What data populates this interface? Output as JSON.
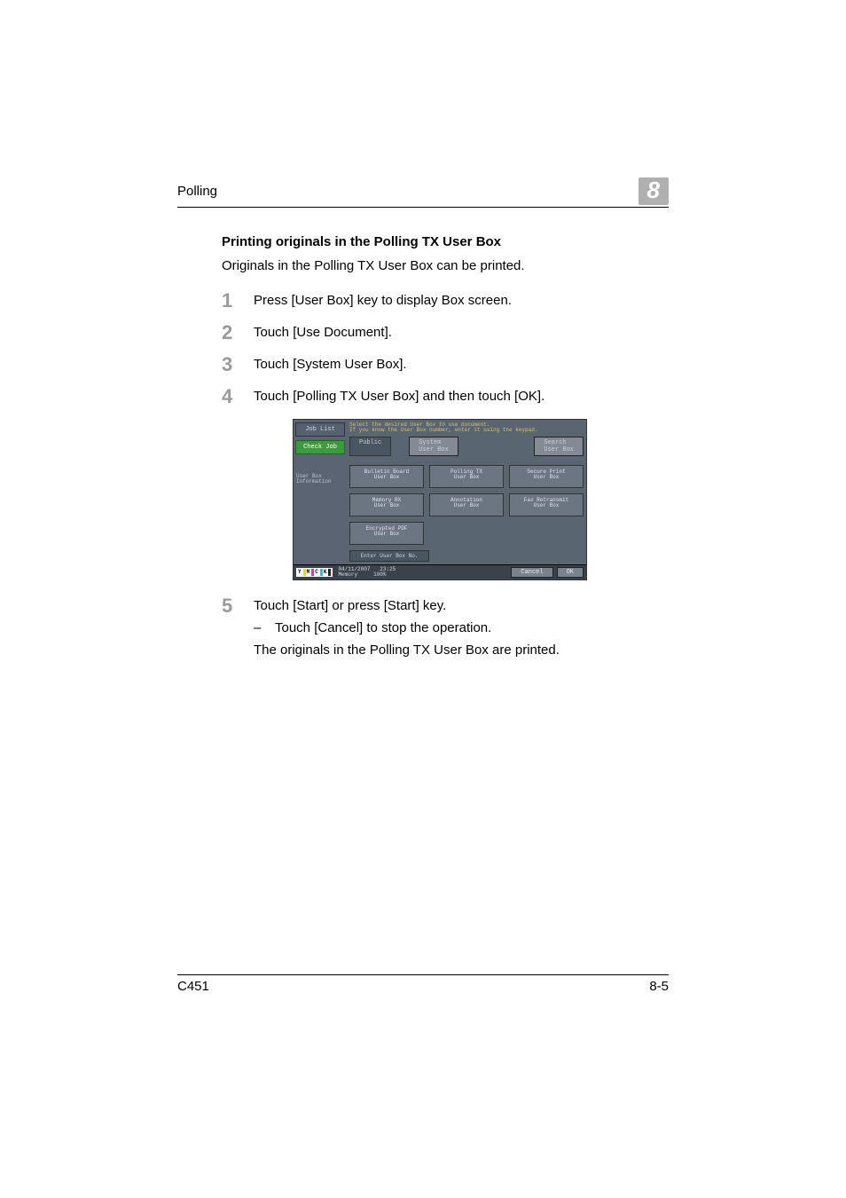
{
  "header": {
    "title": "Polling",
    "chapter": "8"
  },
  "section_heading": "Printing originals in the Polling TX User Box",
  "intro": "Originals in the Polling TX User Box can be printed.",
  "steps": [
    {
      "num": "1",
      "text": "Press [User Box] key to display Box screen."
    },
    {
      "num": "2",
      "text": "Touch [Use Document]."
    },
    {
      "num": "3",
      "text": "Touch [System User Box]."
    },
    {
      "num": "4",
      "text": "Touch [Polling TX User Box] and then touch [OK]."
    }
  ],
  "screenshot": {
    "side": {
      "job_list": "Job List",
      "check_job": "Check Job",
      "info_label": "User Box\nInformation"
    },
    "hint": "Select the desired User Box to use document.\nIf you know the User Box number, enter it using the keypad.",
    "tabs": {
      "public": "Public",
      "system": "System\nUser Box",
      "search": "Search\nUser Box"
    },
    "boxes": {
      "bulletin": "Bulletin Board\nUser Box",
      "polling": "Polling TX\nUser Box",
      "secure": "Secure Print\nUser Box",
      "memory": "Memory RX\nUser Box",
      "annotation": "Annotation\nUser Box",
      "fax_retx": "Fax Retransmit\nUser Box",
      "encrypted": "Encrypted PDF\nUser Box"
    },
    "enter_box": "Enter User Box No.",
    "footer": {
      "date": "04/11/2007",
      "time": "23:25",
      "mem_label": "Memory",
      "mem_val": "100%",
      "cancel": "Cancel",
      "ok": "OK"
    }
  },
  "step5": {
    "num": "5",
    "text": "Touch [Start] or press [Start] key.",
    "sub": "Touch [Cancel] to stop the operation.",
    "follow": "The originals in the Polling TX User Box are printed."
  },
  "footer": {
    "model": "C451",
    "page": "8-5"
  }
}
